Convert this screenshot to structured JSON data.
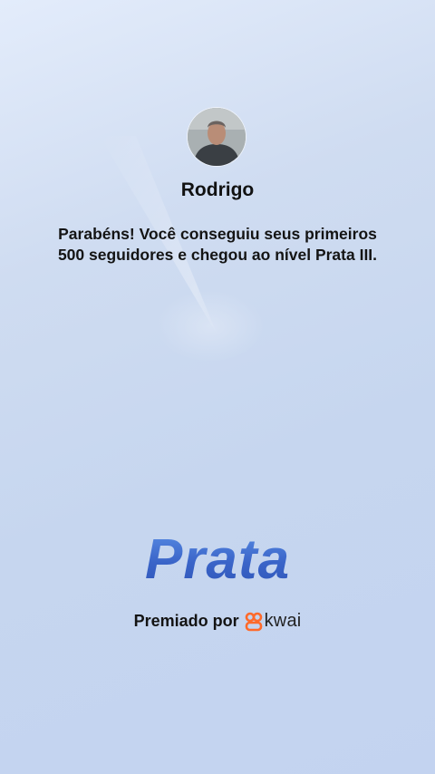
{
  "user": {
    "name": "Rodrigo"
  },
  "message": {
    "line1": "Parabéns! Você conseguiu seus primeiros",
    "line2": "500 seguidores e chegou ao nível Prata III."
  },
  "level": {
    "title": "Prata"
  },
  "award": {
    "label": "Premiado por",
    "brand": "kwai",
    "brand_icon": "kwai-logo-icon",
    "brand_color": "#ff6a2b"
  },
  "colors": {
    "level_text": "#3d6fd1",
    "background": "#c6d6ef"
  }
}
